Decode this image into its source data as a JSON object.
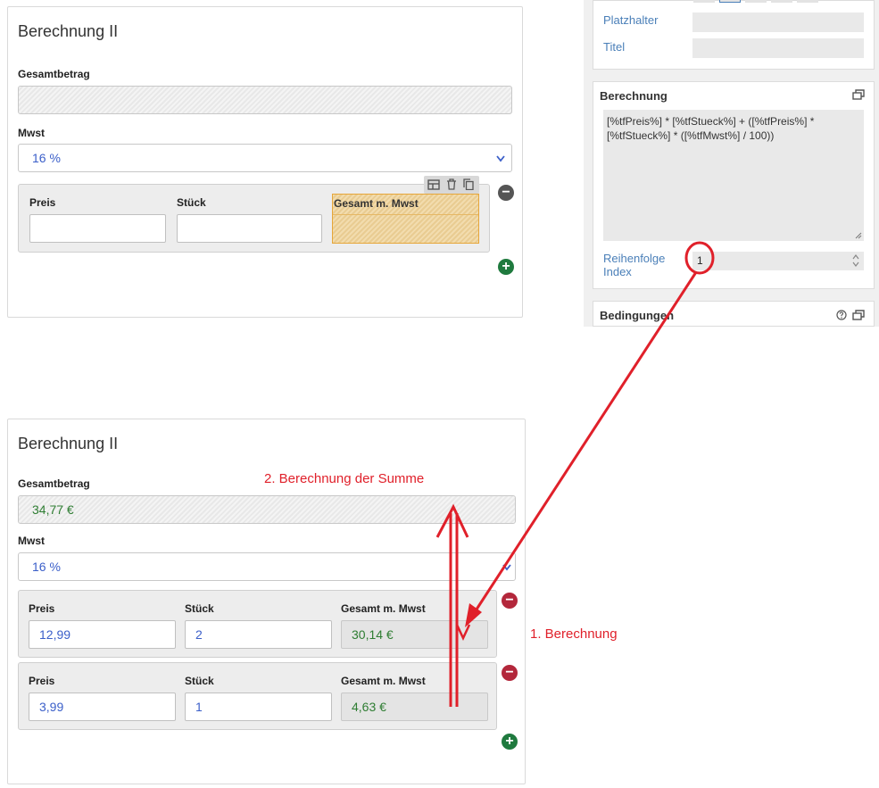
{
  "form_top": {
    "title": "Berechnung II",
    "total_label": "Gesamtbetrag",
    "total_value": "",
    "vat_label": "Mwst",
    "vat_value": "16 %",
    "row": {
      "price_label": "Preis",
      "qty_label": "Stück",
      "total_label": "Gesamt m. Mwst"
    }
  },
  "form_bottom": {
    "title": "Berechnung II",
    "total_label": "Gesamtbetrag",
    "total_value": "34,77 €",
    "vat_label": "Mwst",
    "vat_value": "16 %",
    "rows": [
      {
        "price_label": "Preis",
        "qty_label": "Stück",
        "total_label": "Gesamt m. Mwst",
        "price": "12,99",
        "qty": "2",
        "total": "30,14 €"
      },
      {
        "price_label": "Preis",
        "qty_label": "Stück",
        "total_label": "Gesamt m. Mwst",
        "price": "3,99",
        "qty": "1",
        "total": "4,63 €"
      }
    ]
  },
  "sidebar": {
    "placeholder_label": "Platzhalter",
    "title_label": "Titel",
    "calc_header": "Berechnung",
    "formula": "[%tfPreis%] * [%tfStueck%] + ([%tfPreis%] * [%tfStueck%]  * ([%tfMwst%] / 100))",
    "order_label_1": "Reihenfolge",
    "order_label_2": "Index",
    "order_value": "1",
    "conditions_header": "Bedingungen"
  },
  "annotations": {
    "sum": "2. Berechnung der Summe",
    "first": "1. Berechnung"
  },
  "colors": {
    "annotation": "#e0202a",
    "field_text": "#3b5fc9",
    "result_text": "#2e7d32",
    "highlight": "#f0d9a8"
  }
}
